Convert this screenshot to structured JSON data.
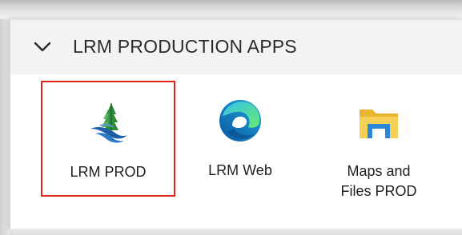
{
  "group": {
    "title": "LRM PRODUCTION APPS",
    "expanded": true
  },
  "apps": [
    {
      "label": "LRM PROD",
      "icon": "lrm-logo-icon",
      "selected": true
    },
    {
      "label": "LRM Web",
      "icon": "edge-browser-icon",
      "selected": false
    },
    {
      "label_line1": "Maps and",
      "label_line2": "Files PROD",
      "icon": "folder-icon",
      "selected": false
    }
  ],
  "colors": {
    "selection_border": "#e0251b",
    "header_bg": "#f3f3f3",
    "text": "#1f1f1f"
  }
}
